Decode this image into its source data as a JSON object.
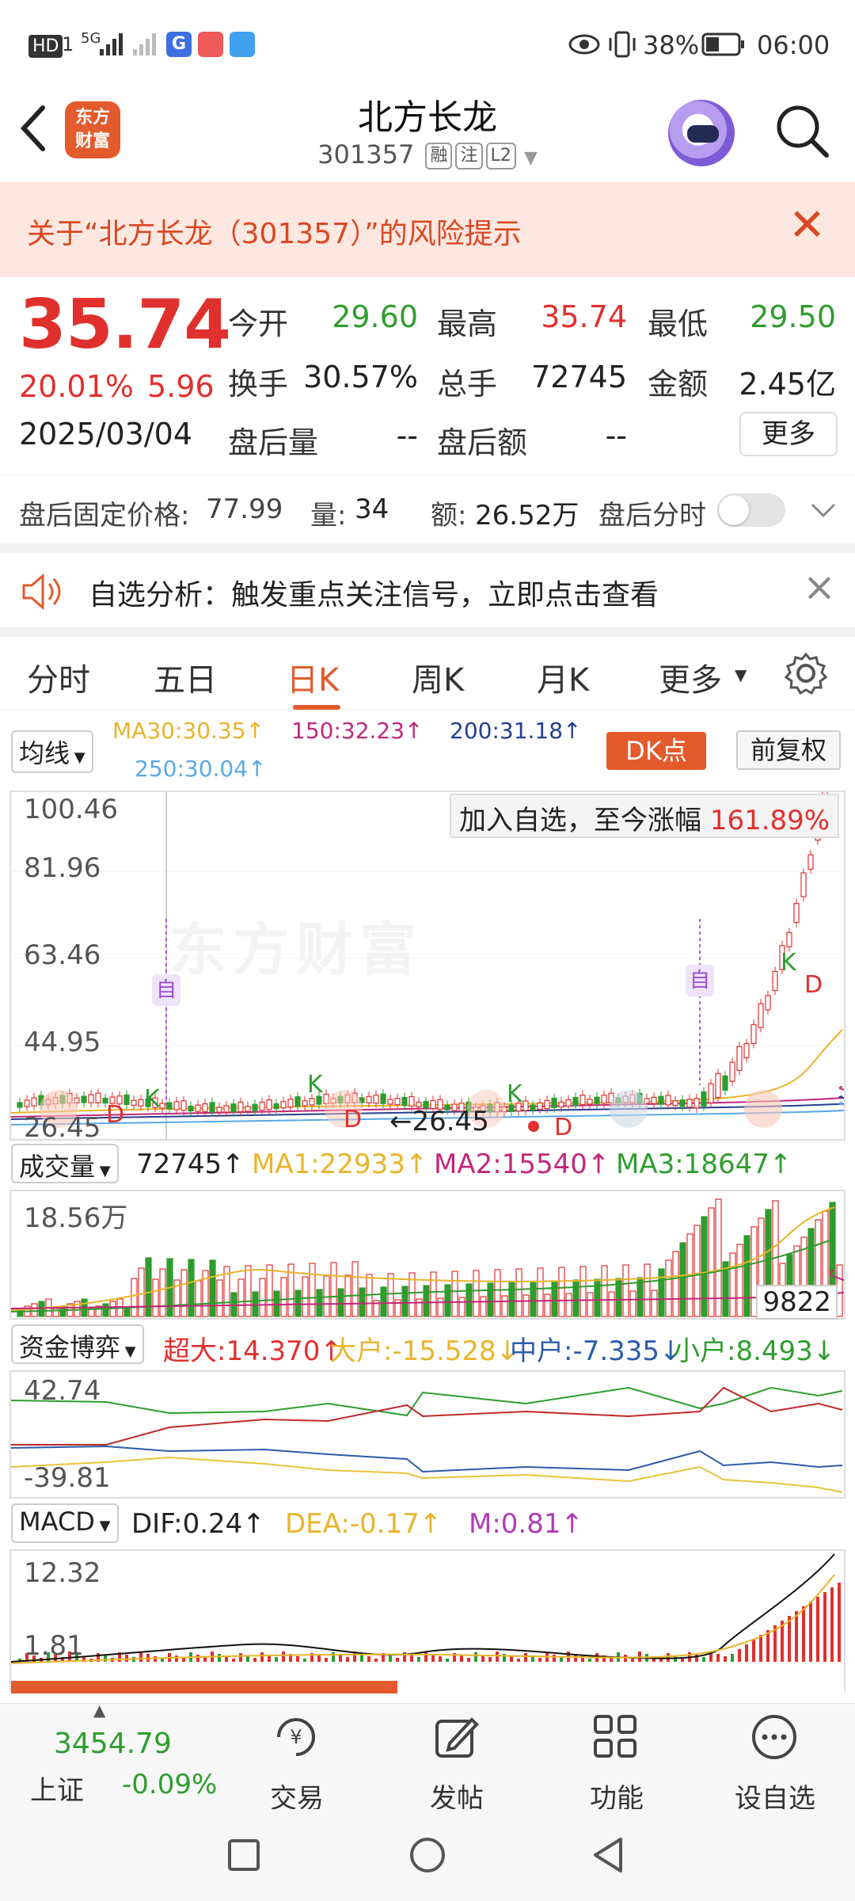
{
  "status_bar": {
    "left_icons": [
      "HD",
      "1",
      "5G",
      "signal-icon",
      "signal-icon",
      "app-icon-g",
      "app-icon-mail",
      "app-icon-weather"
    ],
    "battery": "38%",
    "time": "06:00"
  },
  "header": {
    "logo_text_line1": "东方",
    "logo_text_line2": "财富",
    "stock_name": "北方长龙",
    "stock_code": "301357",
    "tags": [
      "融",
      "注",
      "L2"
    ]
  },
  "risk_banner": {
    "text": "关于“北方长龙（301357）”的风险提示",
    "close": "✕"
  },
  "quote": {
    "price": "35.74",
    "change_pct": "20.01%",
    "change_amt": "5.96",
    "date": "2025/03/04",
    "fields": [
      {
        "label": "今开",
        "value": "29.60"
      },
      {
        "label": "最高",
        "value": "35.74"
      },
      {
        "label": "最低",
        "value": "29.50"
      },
      {
        "label": "换手",
        "value": "30.57%"
      },
      {
        "label": "总手",
        "value": "72745"
      },
      {
        "label": "金额",
        "value": "2.45亿"
      },
      {
        "label": "盘后量",
        "value": "--"
      },
      {
        "label": "盘后额",
        "value": "--"
      }
    ],
    "more_label": "更多"
  },
  "after_hours": {
    "fixed_price_label": "盘后固定价格:",
    "fixed_price": "77.99",
    "volume_label": "量:",
    "volume": "34",
    "amount_label": "额:",
    "amount": "26.52万",
    "timeshare_label": "盘后分时"
  },
  "analysis": {
    "text": "自选分析：触发重点关注信号，立即点击查看"
  },
  "tabs": [
    "分时",
    "五日",
    "日K",
    "周K",
    "月K",
    "更多"
  ],
  "active_tab": "日K",
  "chart_header": {
    "indicator": "均线",
    "ma30": "MA30:30.35↑",
    "ma150": "150:32.23↑",
    "ma200": "200:31.18↑",
    "ma250": "250:30.04↑",
    "dk_label": "DK点",
    "restore_label": "前复权"
  },
  "kline": {
    "y_labels": [
      "100.46",
      "81.96",
      "63.46",
      "44.95",
      "26.45"
    ],
    "watermark": "东方财富",
    "gain_label": "加入自选，至今涨幅",
    "gain_value": "161.89%",
    "low_marker": "←26.45",
    "self_marker": "自",
    "markers": [
      "K",
      "D",
      "K",
      "D",
      "K",
      "D",
      "K",
      "D"
    ]
  },
  "volume": {
    "indicator": "成交量",
    "value": "72745↑",
    "ma1": "MA1:22933↑",
    "ma2": "MA2:15540↑",
    "ma3": "MA3:18647↑",
    "y_top": "18.56万",
    "y_right": "9822"
  },
  "fund": {
    "indicator": "资金博弈",
    "super": "超大:14.370↑",
    "big": "大户:-15.528↓",
    "mid": "中户:-7.335↓",
    "small": "小户:8.493↓",
    "y_top": "42.74",
    "y_bottom": "-39.81"
  },
  "macd": {
    "indicator": "MACD",
    "dif": "DIF:0.24↑",
    "dea": "DEA:-0.17↑",
    "m": "M:0.81↑",
    "y_top": "12.32",
    "y_mid": "1.81"
  },
  "bottom_nav": {
    "index_value": "3454.79",
    "index_name": "上证",
    "index_change": "-0.09%",
    "items": [
      "交易",
      "发帖",
      "功能",
      "设自选"
    ]
  },
  "colors": {
    "accent": "#e35b2c",
    "up": "#e0302e",
    "down": "#2e9d2e"
  }
}
